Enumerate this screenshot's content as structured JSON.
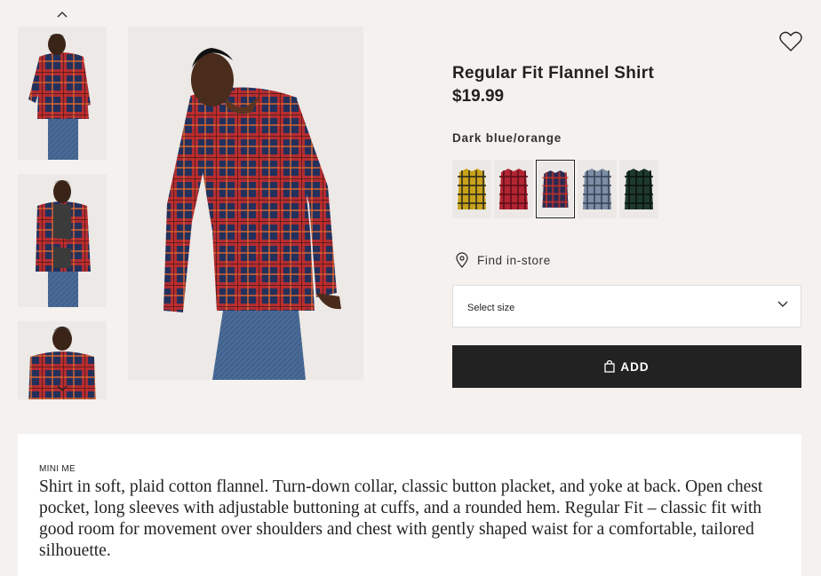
{
  "product": {
    "title": "Regular Fit Flannel Shirt",
    "price": "$19.99",
    "color_name": "Dark blue/orange"
  },
  "gallery": {
    "thumbnails": [
      {
        "alt": "Model looking down wearing plaid shirt"
      },
      {
        "alt": "Model with arms crossed wearing open plaid shirt"
      },
      {
        "alt": "Back view of plaid shirt"
      }
    ],
    "prev_icon": "chevron-up-icon",
    "next_icon": "chevron-down-icon"
  },
  "swatches": [
    {
      "name": "Yellow/black",
      "base": "#c9a21a",
      "line": "#2a2a1a",
      "selected": false
    },
    {
      "name": "Red",
      "base": "#b32532",
      "line": "#5c0f18",
      "selected": false
    },
    {
      "name": "Dark blue/orange",
      "base": "#2a2a52",
      "line": "#c8322a",
      "selected": true
    },
    {
      "name": "Blue/grey",
      "base": "#7d8da6",
      "line": "#3c4658",
      "selected": false
    },
    {
      "name": "Dark green",
      "base": "#1f3a2c",
      "line": "#0a1410",
      "selected": false
    }
  ],
  "store": {
    "find_label": "Find in-store",
    "icon": "location-pin-icon"
  },
  "size": {
    "placeholder": "Select size",
    "icon": "chevron-down-icon"
  },
  "cart": {
    "add_label": "ADD",
    "icon": "shopping-bag-icon"
  },
  "favorite": {
    "icon": "heart-icon"
  },
  "description": {
    "label": "MINI ME",
    "text": "Shirt in soft, plaid cotton flannel. Turn-down collar, classic button placket, and yoke at back. Open chest pocket, long sleeves with adjustable buttoning at cuffs, and a rounded hem. Regular Fit – classic fit with good room for movement over shoulders and chest with gently shaped waist for a comfortable, tailored silhouette."
  },
  "colors": {
    "background": "#f4f1ee",
    "text": "#222222",
    "button": "#222222",
    "plaid_red": "#d4302a",
    "plaid_navy": "#1e2a55",
    "denim": "#4a6a96"
  }
}
